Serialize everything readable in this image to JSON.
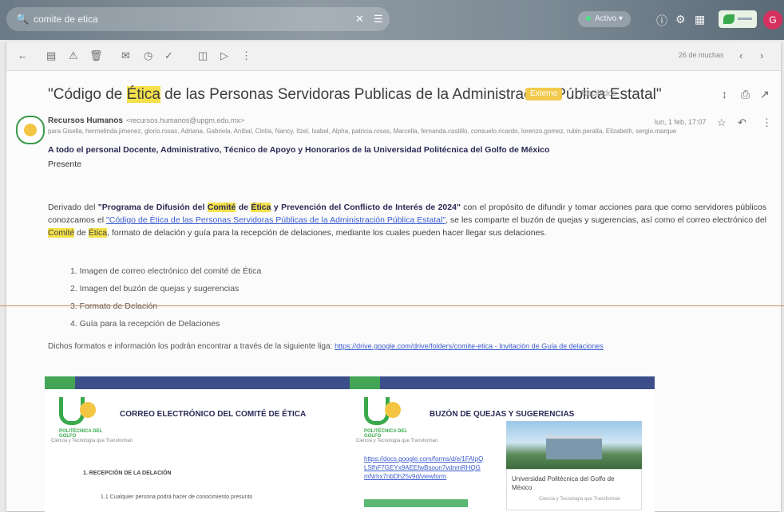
{
  "topbar": {
    "search_query": "comite de etica",
    "status_label": "Activo",
    "avatar_letter": "G"
  },
  "toolbar": {
    "page_info": "26 de muchas"
  },
  "email": {
    "subject_pre": "\"Código de ",
    "subject_hl": "Ética",
    "subject_post": " de las Personas Servidoras Publicas de la Administración Pública Estatal\"",
    "label_badge": "Externo",
    "label_inbox": "Recibidos",
    "sender_name": "Recursos Humanos",
    "sender_email": "<recursos.humanos@upgm.edu.mx>",
    "recipients": "para Gisella, hermelinda.jimenez, glorio.rosas, Adriana, Gabriela, Aníbal, Cintia, Nancy, Itzel, Isabel, Alpha, patricia.rosas, Marcella, fernanda.castillo, consuelo.ricardo, lorenzo.gomez, rubin.peralta, Elizabeth, sergio.marque",
    "date": "lun, 1 feb, 17:07",
    "to_line": "A todo el personal Docente, Administrativo, Técnico de Apoyo y Honorarios de la Universidad Politécnica del Golfo de México",
    "presente": "Presente",
    "p1_a": "Derivado del ",
    "p1_b": "\"Programa de Difusión del ",
    "p1_c": "Comité",
    "p1_d": " de ",
    "p1_e": "Ética",
    "p1_f": " y Prevención del Conflicto de Interés de 2024\"",
    "p1_g": " con el propósito de difundir y tomar acciones para que como servidores públicos conozcamos el ",
    "p1_link": "\"Código de Ética de las Personas Servidoras Públicas de la Administración Pública Estatal\"",
    "p1_h": ", se les comparte el buzón de quejas y sugerencias, así como el correo electrónico del ",
    "p1_i": "Comité",
    "p1_j": " de ",
    "p1_k": "Ética",
    "p1_l": ", formato de delación y guía para la recepción de delaciones, mediante los cuales pueden hacer llegar sus delaciones.",
    "list": [
      "1. Imagen de correo electrónico del comité de Ética",
      "2. Imagen del buzón de quejas y sugerencias",
      "3. Formato de Delación",
      "4. Guía para la recepción de Delaciones"
    ],
    "formats_text": "Dichos formatos e información los podrán encontrar a través de la siguiente liga: ",
    "formats_link": "https://drive.google.com/drive/folders/comite-etica - Invitación de Guía de delaciones"
  },
  "cards": {
    "left_title": "CORREO ELECTRÓNICO DEL COMITÉ DE ÉTICA",
    "left_sub": "1. RECEPCIÓN DE LA DELACIÓN",
    "left_line": "1.1 Cualquier persona podrá hacer de conocimiento presunto",
    "right_title": "BUZÓN DE QUEJAS Y SUGERENCIAS",
    "right_link": "https://docs.google.com/forms/d/e/1FAIpQLSfhF7GEYx9AEEfwBsoun7vdnmRHQGmNrhx7nbDh25v9d/viewform",
    "photo_caption": "Universidad Politécnica del Golfo de México",
    "photo_sub": "Ciencia y Tecnología que Transforman",
    "logo_cap": "POLITÉCNICA DEL GOLFO",
    "slogan": "Ciencia y Tecnología que Transforman"
  }
}
